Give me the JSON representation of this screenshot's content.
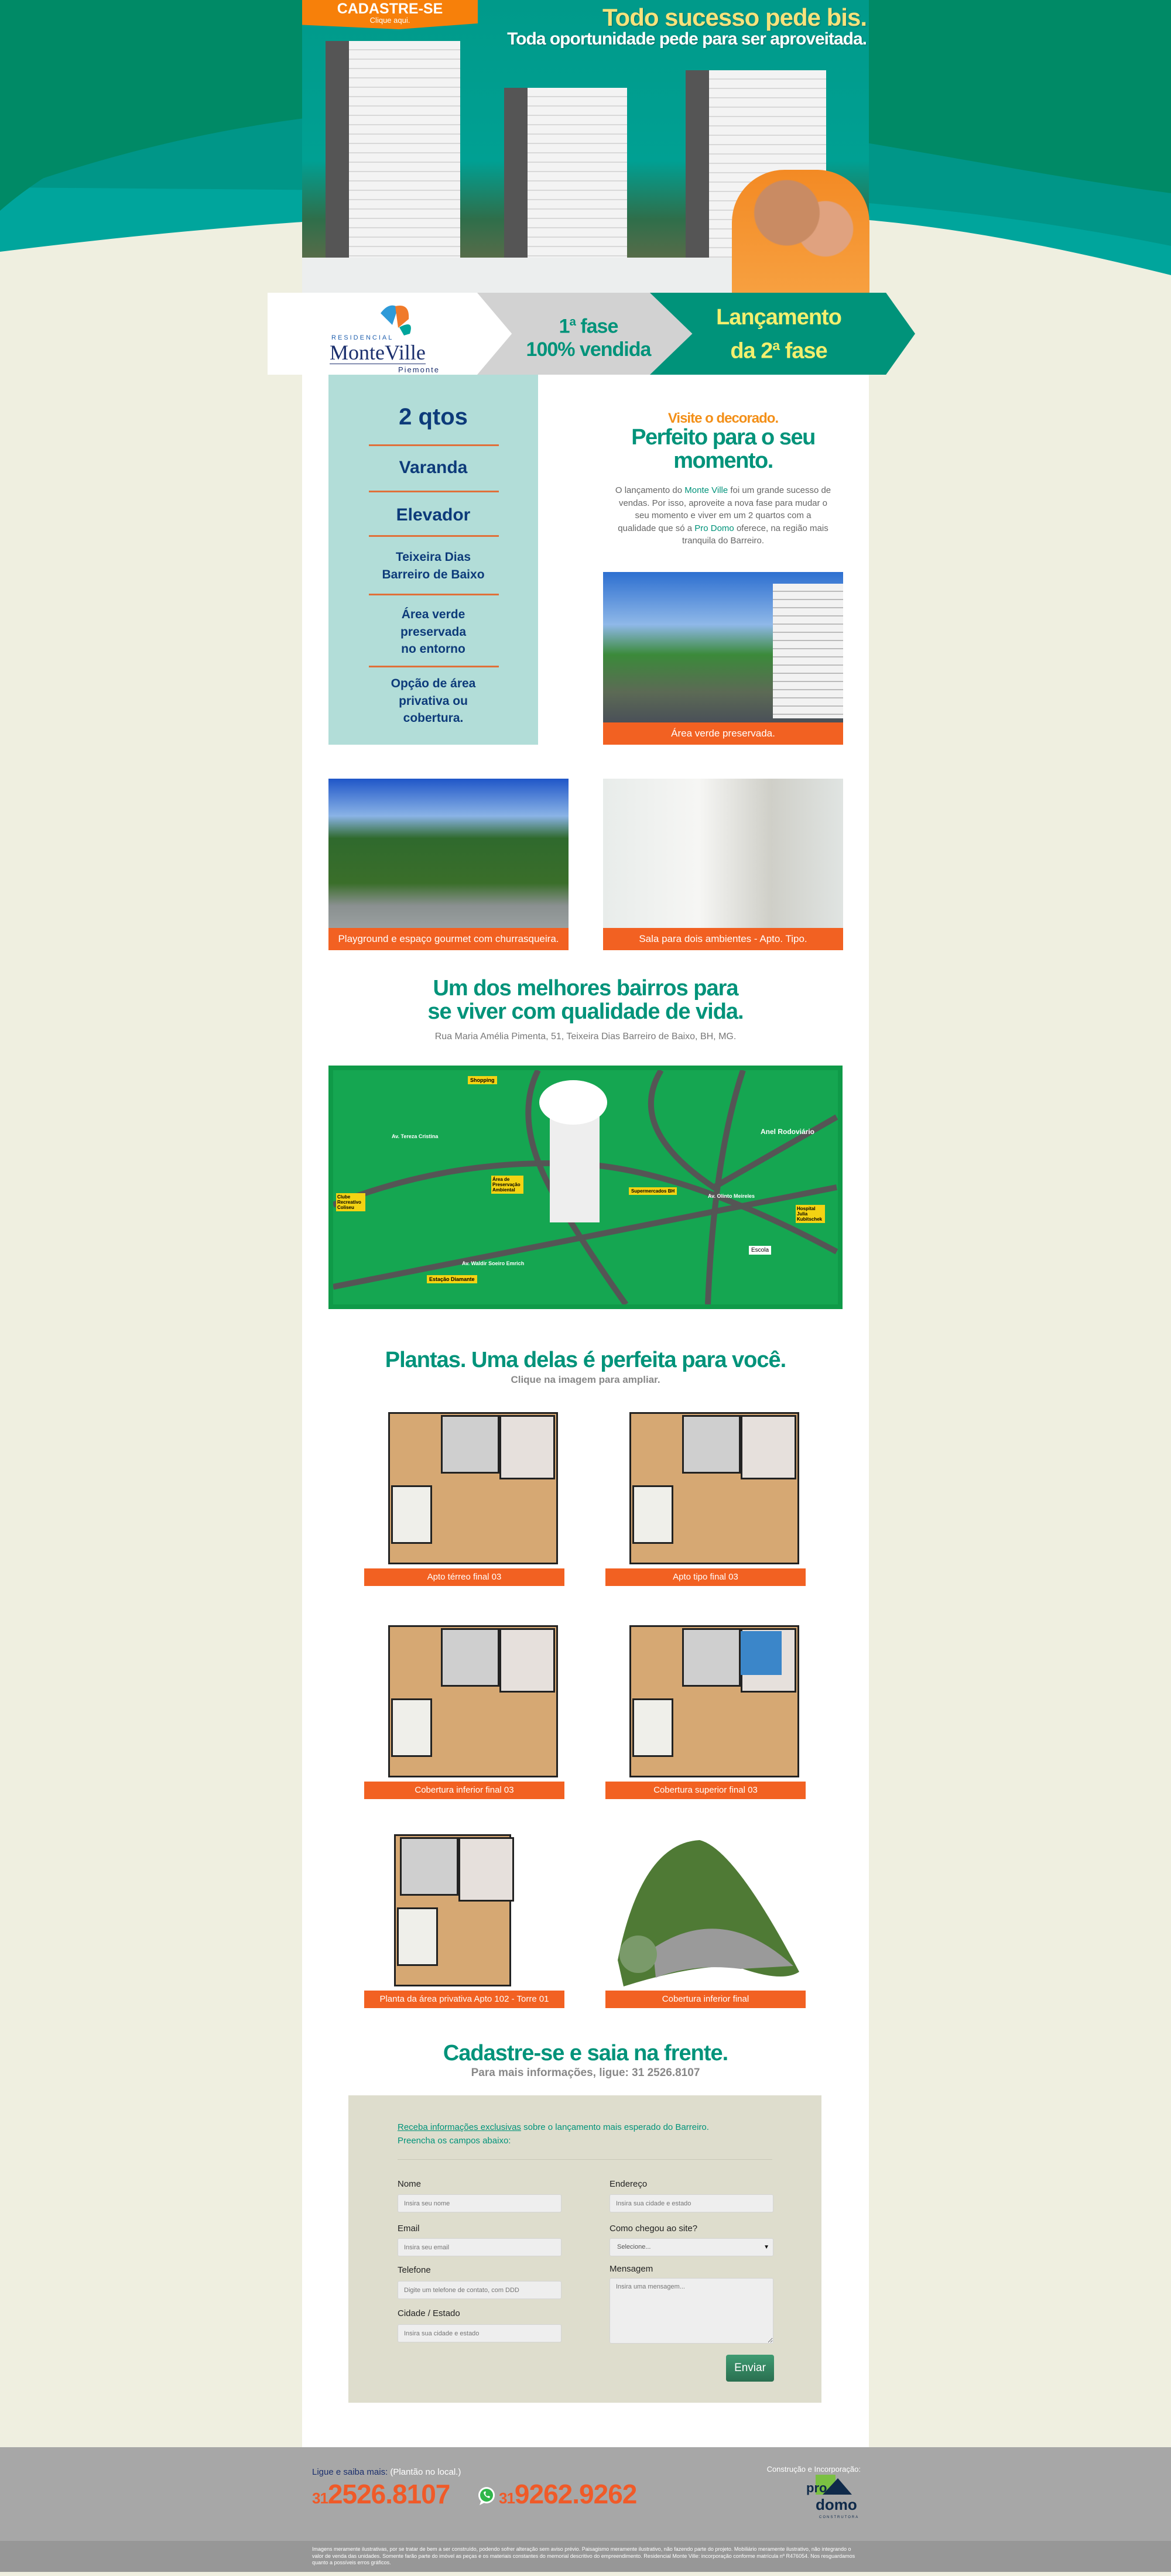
{
  "colors": {
    "brand_green": "#00937a",
    "orange": "#f26122",
    "tab_orange": "#f7800a",
    "navy": "#0d3b7a",
    "feature_bg": "#b2ddd8",
    "form_bg": "#deddcd",
    "footer_bg": "#a7a7a7",
    "page_bg": "#efefe0"
  },
  "hero": {
    "cta_title": "CADASTRE-SE",
    "cta_sub": "Clique aqui.",
    "headline": "Todo sucesso pede bis.",
    "subheadline": "Toda oportunidade pede para ser aproveitada."
  },
  "banner": {
    "logo_residencial": "RESIDENCIAL",
    "logo_name": "MonteVille",
    "logo_place": "Piemonte",
    "phase1_a": "1",
    "phase1_sup": "a",
    "phase1_b": " fase",
    "phase1_line2": "100% vendida",
    "phase2_line1": "Lançamento",
    "phase2_a": "da 2",
    "phase2_sup": "a",
    "phase2_b": " fase"
  },
  "features": [
    "2 qtos",
    "Varanda",
    "Elevador",
    "Teixeira Dias",
    "Barreiro de Baixo",
    "Área verde",
    "preservada",
    "no entorno",
    "Opção de área",
    "privativa ou",
    "cobertura."
  ],
  "intro": {
    "kicker": "Visite o decorado.",
    "title_l1": "Perfeito para o seu",
    "title_l2": "momento.",
    "p1": "O lançamento do ",
    "h1": "Monte Ville",
    "p2": " foi um grande sucesso de vendas. Por isso, aproveite a nova fase para mudar o seu momento e viver em um 2 quartos com a qualidade que só a ",
    "h2": "Pro Domo",
    "p3": " oferece, na região mais tranquila do Barreiro.",
    "photo_caption": "Área verde preservada."
  },
  "gallery": [
    {
      "caption": "Playground e espaço gourmet com churrasqueira."
    },
    {
      "caption": "Sala para dois ambientes - Apto. Tipo."
    }
  ],
  "location": {
    "title_l1": "Um dos melhores bairros para",
    "title_l2": "se viver com qualidade de vida.",
    "address": "Rua Maria Amélia Pimenta, 51, Teixeira Dias Barreiro de  Baixo, BH, MG.",
    "map_labels": [
      "Shopping",
      "Anel Rodoviário",
      "Av. Tereza Cristina",
      "Av. Olinto Meireles",
      "Av. Waldir Soeiro Emrich",
      "Estação Diamante",
      "Escola",
      "Hospital Julia Kubitschek",
      "Supermercados BH",
      "Área de Preservação Ambiental",
      "Clube Recreativo Coliseu"
    ]
  },
  "plans": {
    "title": "Plantas. Uma delas é perfeita para você.",
    "subtitle": "Clique na imagem para ampliar.",
    "items": [
      {
        "caption": "Apto térreo final 03"
      },
      {
        "caption": "Apto tipo final 03"
      },
      {
        "caption": "Cobertura inferior final 03"
      },
      {
        "caption": "Cobertura superior final 03"
      },
      {
        "caption": "Planta da área privativa Apto 102 - Torre 01"
      },
      {
        "caption": "Cobertura inferior final"
      }
    ]
  },
  "signup": {
    "title": "Cadastre-se e saia na frente.",
    "subtitle": "Para mais informações, ligue: 31 2526.8107",
    "intro_link": "Receba informações exclusivas",
    "intro_rest": " sobre o lançamento mais esperado do Barreiro.",
    "intro_l2": "Preencha os campos abaixo:",
    "fields": {
      "nome": {
        "label": "Nome",
        "placeholder": "Insira seu nome"
      },
      "email": {
        "label": "Email",
        "placeholder": "Insira seu email"
      },
      "telefone": {
        "label": "Telefone",
        "placeholder": "Digite um telefone de contato, com DDD"
      },
      "cidade": {
        "label": "Cidade / Estado",
        "placeholder": "Insira sua cidade e estado"
      },
      "endereco": {
        "label": "Endereço",
        "placeholder": "Insira sua cidade e estado"
      },
      "origem": {
        "label": "Como chegou ao site?",
        "selected": "Selecione..."
      },
      "mensagem": {
        "label": "Mensagem",
        "placeholder": "Insira uma mensagem..."
      }
    },
    "submit": "Enviar"
  },
  "footer": {
    "call_label": "Ligue e saiba mais:",
    "call_note": " (Plantão no local.)",
    "phone1_ddd": "31",
    "phone1": "2526.8107",
    "phone2_ddd": "31",
    "phone2": "9262.9262",
    "builder_label": "Construção e Incorporação:",
    "builder_logo": "pro domo CONSTRUTORA",
    "disclaimer": "Imagens meramente ilustrativas, por se tratar de bem a ser construído, podendo sofrer alteração sem aviso prévio. Paisagismo meramente ilustrativo, não fazendo parte do projeto. Mobiliário meramente ilustrativo, não integrando o valor de venda das unidades. Somente farão parte do imóvel as peças e os materiais constantes do memorial descritivo do empreendimento. Residencial Monte Ville: incorporação conforme matrícula nº R476054. Nos resguardamos quanto a possíveis erros gráficos."
  }
}
